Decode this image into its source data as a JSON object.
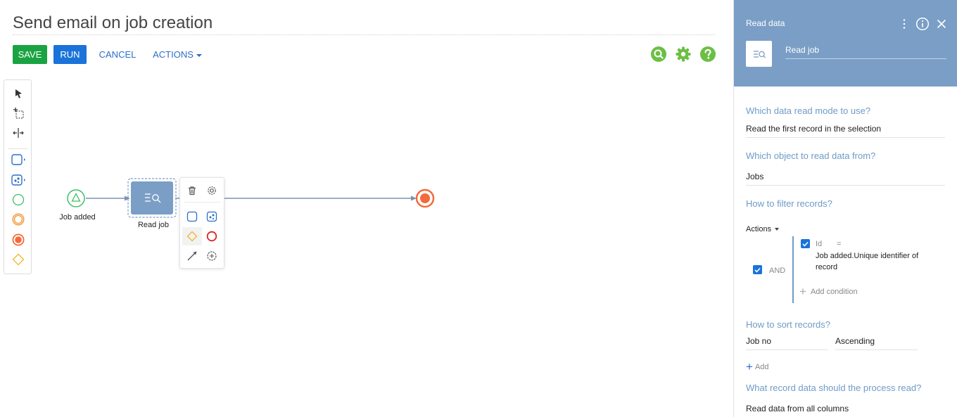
{
  "header": {
    "title": "Send email on job creation",
    "save_label": "SAVE",
    "run_label": "RUN",
    "cancel_label": "CANCEL",
    "actions_label": "ACTIONS"
  },
  "diagram": {
    "start_label": "Job added",
    "task_label": "Read job"
  },
  "panel": {
    "title": "Read data",
    "element_name": "Read job",
    "q_mode": "Which data read mode to use?",
    "v_mode": "Read the first record in the selection",
    "q_object": "Which object to read data from?",
    "v_object": "Jobs",
    "q_filter": "How to filter records?",
    "filter_actions": "Actions",
    "filter_and": "AND",
    "filter_field": "Id",
    "filter_op": "=",
    "filter_value": "Job added.Unique identifier of record",
    "add_condition": "Add condition",
    "q_sort": "How to sort records?",
    "sort_column": "Job no",
    "sort_direction": "Ascending",
    "add_sort": "Add",
    "q_read": "What record data should the process read?",
    "v_read": "Read data from all columns"
  },
  "colors": {
    "save": "#1aa342",
    "run": "#1a73d9",
    "link": "#2c6fc9",
    "panel_header": "#7a9ec6",
    "question": "#6f9bc7",
    "top_icons": "#6cbf45",
    "end_event": "#f26b3a",
    "start_event": "#3fbf68"
  }
}
